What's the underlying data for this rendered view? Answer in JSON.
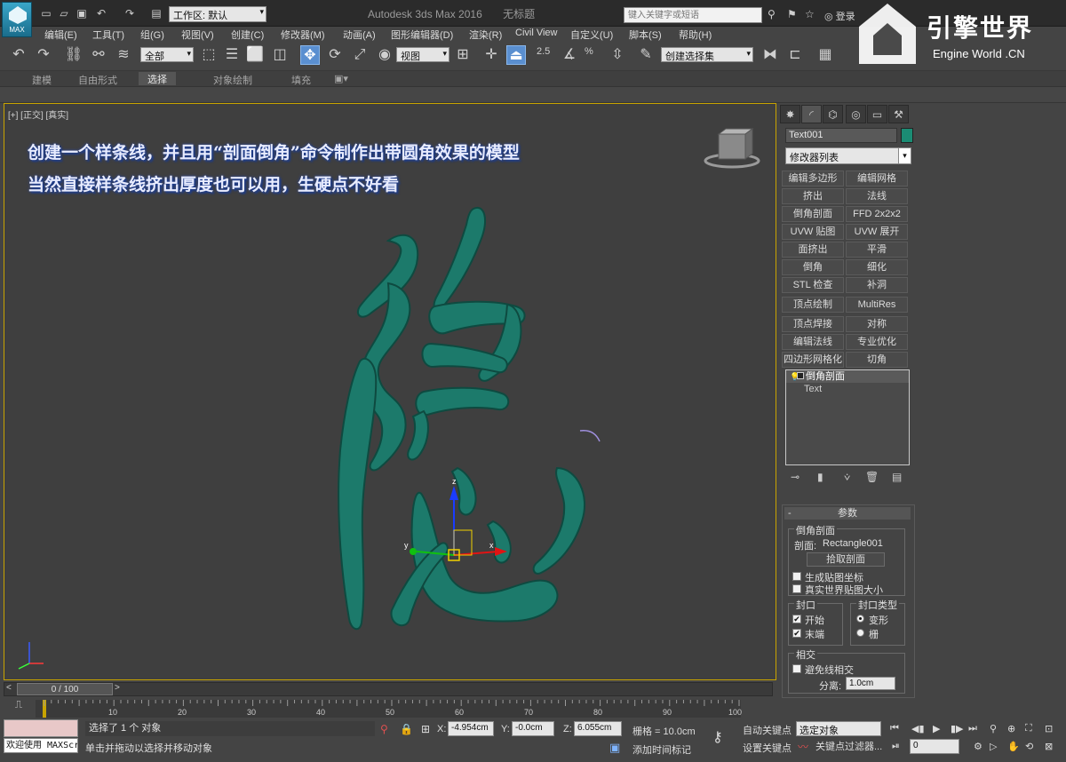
{
  "titlebar": {
    "logo_text": "MAX",
    "workspace_label": "工作区: 默认",
    "app_name": "Autodesk 3ds Max 2016",
    "doc_name": "无标题",
    "search_placeholder": "键入关键字或短语",
    "login_label": "登录"
  },
  "watermark": {
    "title": "引擎世界",
    "subtitle": "Engine World .CN"
  },
  "menu": [
    "编辑(E)",
    "工具(T)",
    "组(G)",
    "视图(V)",
    "创建(C)",
    "修改器(M)",
    "动画(A)",
    "图形编辑器(D)",
    "渲染(R)",
    "Civil View",
    "自定义(U)",
    "脚本(S)",
    "帮助(H)"
  ],
  "toolbar": {
    "filter_value": "全部",
    "refcoord_value": "视图",
    "selset_value": "创建选择集",
    "snap_labels": [
      "2.5",
      "%"
    ]
  },
  "ribbon": {
    "tabs": [
      "建模",
      "自由形式",
      "选择",
      "对象绘制",
      "填充"
    ],
    "active": "选择"
  },
  "viewport": {
    "label": "[+] [正交] [真实]",
    "annotation_line1": "创建一个样条线，并且用“剖面倒角”命令制作出带圆角效果的模型",
    "annotation_line2": "当然直接样条线挤出厚度也可以用，生硬点不好看",
    "glyph": "隐",
    "glyph_color": "#1c7a6b",
    "border_color": "#c8a400",
    "gizmo_axes": [
      "z",
      "x",
      "y"
    ]
  },
  "command_panel": {
    "object_name": "Text001",
    "object_color": "#1b8c74",
    "modifier_list_label": "修改器列表",
    "modifier_buttons": [
      "编辑多边形",
      "编辑网格",
      "挤出",
      "法线",
      "倒角剖面",
      "FFD 2x2x2",
      "UVW 贴图",
      "UVW 展开",
      "面挤出",
      "平滑",
      "倒角",
      "细化",
      "STL 检查",
      "补洞",
      "顶点绘制",
      "MultiRes",
      "顶点焊接",
      "对称",
      "编辑法线",
      "专业优化",
      "四边形网格化",
      "切角"
    ],
    "stack": {
      "modifier": "倒角剖面",
      "base": "Text"
    }
  },
  "params": {
    "header": "参数",
    "bevel_group": "倒角剖面",
    "profile_label": "剖面:",
    "profile_value": "Rectangle001",
    "pick_button": "拾取剖面",
    "gen_map_coords": "生成贴图坐标",
    "real_world_map": "真实世界贴图大小",
    "cap_group": "封口",
    "cap_start": "开始",
    "cap_end": "末端",
    "cap_start_checked": true,
    "cap_end_checked": true,
    "cap_type_group": "封口类型",
    "cap_morph": "变形",
    "cap_grid": "栅",
    "cap_type_selected": "变形",
    "intersect_group": "相交",
    "avoid_self_intersect": "避免线相交",
    "separation_label": "分离:",
    "separation_value": "1.0cm"
  },
  "timeline": {
    "slider_label": "0 / 100",
    "ticks": [
      "10",
      "20",
      "30",
      "40",
      "50",
      "60",
      "70",
      "80",
      "90",
      "100"
    ]
  },
  "status": {
    "welcome": "欢迎使用 MAXScr",
    "selection": "选择了 1 个 对象",
    "hint": "单击并拖动以选择并移动对象",
    "x_label": "X:",
    "x_value": "-4.954cm",
    "y_label": "Y:",
    "y_value": "-0.0cm",
    "z_label": "Z:",
    "z_value": "6.055cm",
    "grid": "栅格 = 10.0cm",
    "add_time_tag": "添加时间标记",
    "auto_key": "自动关键点",
    "set_key": "设置关键点",
    "selected_value": "选定对象",
    "key_filters": "关键点过滤器...",
    "frame_value": "0"
  }
}
